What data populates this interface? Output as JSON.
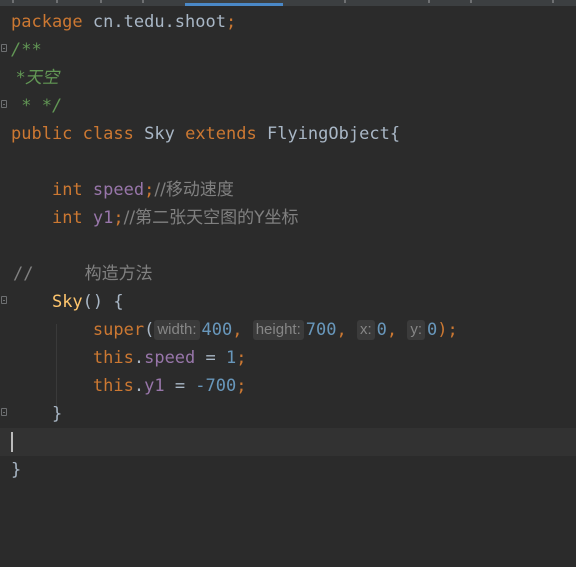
{
  "code": {
    "line1": {
      "keyword": "package",
      "name": "cn.tedu.shoot",
      "semi": ";"
    },
    "line2": {
      "doc_open": "/**"
    },
    "line3": {
      "doc_text": " *天空"
    },
    "line4": {
      "doc_close": " * */"
    },
    "line5": {
      "mod": "public",
      "class_kw": "class",
      "class_name": "Sky",
      "extends_kw": "extends",
      "parent": "FlyingObject",
      "brace": "{"
    },
    "line7": {
      "type": "int",
      "field": "speed",
      "semi": ";",
      "comment": "//移动速度"
    },
    "line8": {
      "type": "int",
      "field": "y1",
      "semi": ";",
      "comment": "//第二张天空图的Y坐标"
    },
    "line10": {
      "comment_mark": "//",
      "comment_text": "构造方法"
    },
    "line11": {
      "ctor": "Sky",
      "parens": "() {"
    },
    "line12": {
      "call": "super",
      "open": "(",
      "hints": [
        {
          "label": "width:",
          "value": "400",
          "sep": ", "
        },
        {
          "label": "height:",
          "value": "700",
          "sep": ", "
        },
        {
          "label": "x:",
          "value": "0",
          "sep": ", "
        },
        {
          "label": "y:",
          "value": "0",
          "sep": ""
        }
      ],
      "close": ");"
    },
    "line13": {
      "this_kw": "this",
      "dot": ".",
      "field": "speed",
      "assign": " = ",
      "value": "1",
      "semi": ";"
    },
    "line14": {
      "this_kw": "this",
      "dot": ".",
      "field": "y1",
      "assign": " = ",
      "value": "-700",
      "semi": ";"
    },
    "line15": {
      "brace": "}"
    },
    "line17": {
      "brace": "}"
    }
  }
}
